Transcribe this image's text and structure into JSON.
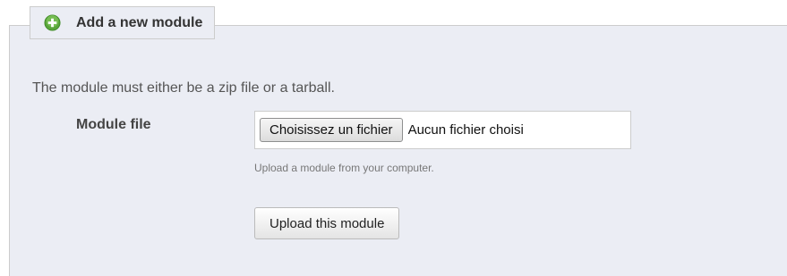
{
  "section": {
    "title": "Add a new module",
    "icon": "add-icon",
    "intro_text": "The module must either be a zip file or a tarball."
  },
  "form": {
    "field_label": "Module file",
    "file_button_label": "Choisissez un fichier",
    "file_status": "Aucun fichier choisi",
    "help_text": "Upload a module from your computer.",
    "submit_label": "Upload this module"
  },
  "colors": {
    "panel_background": "#ebedf4",
    "border": "#cccccc",
    "icon_green": "#5aa63b"
  }
}
